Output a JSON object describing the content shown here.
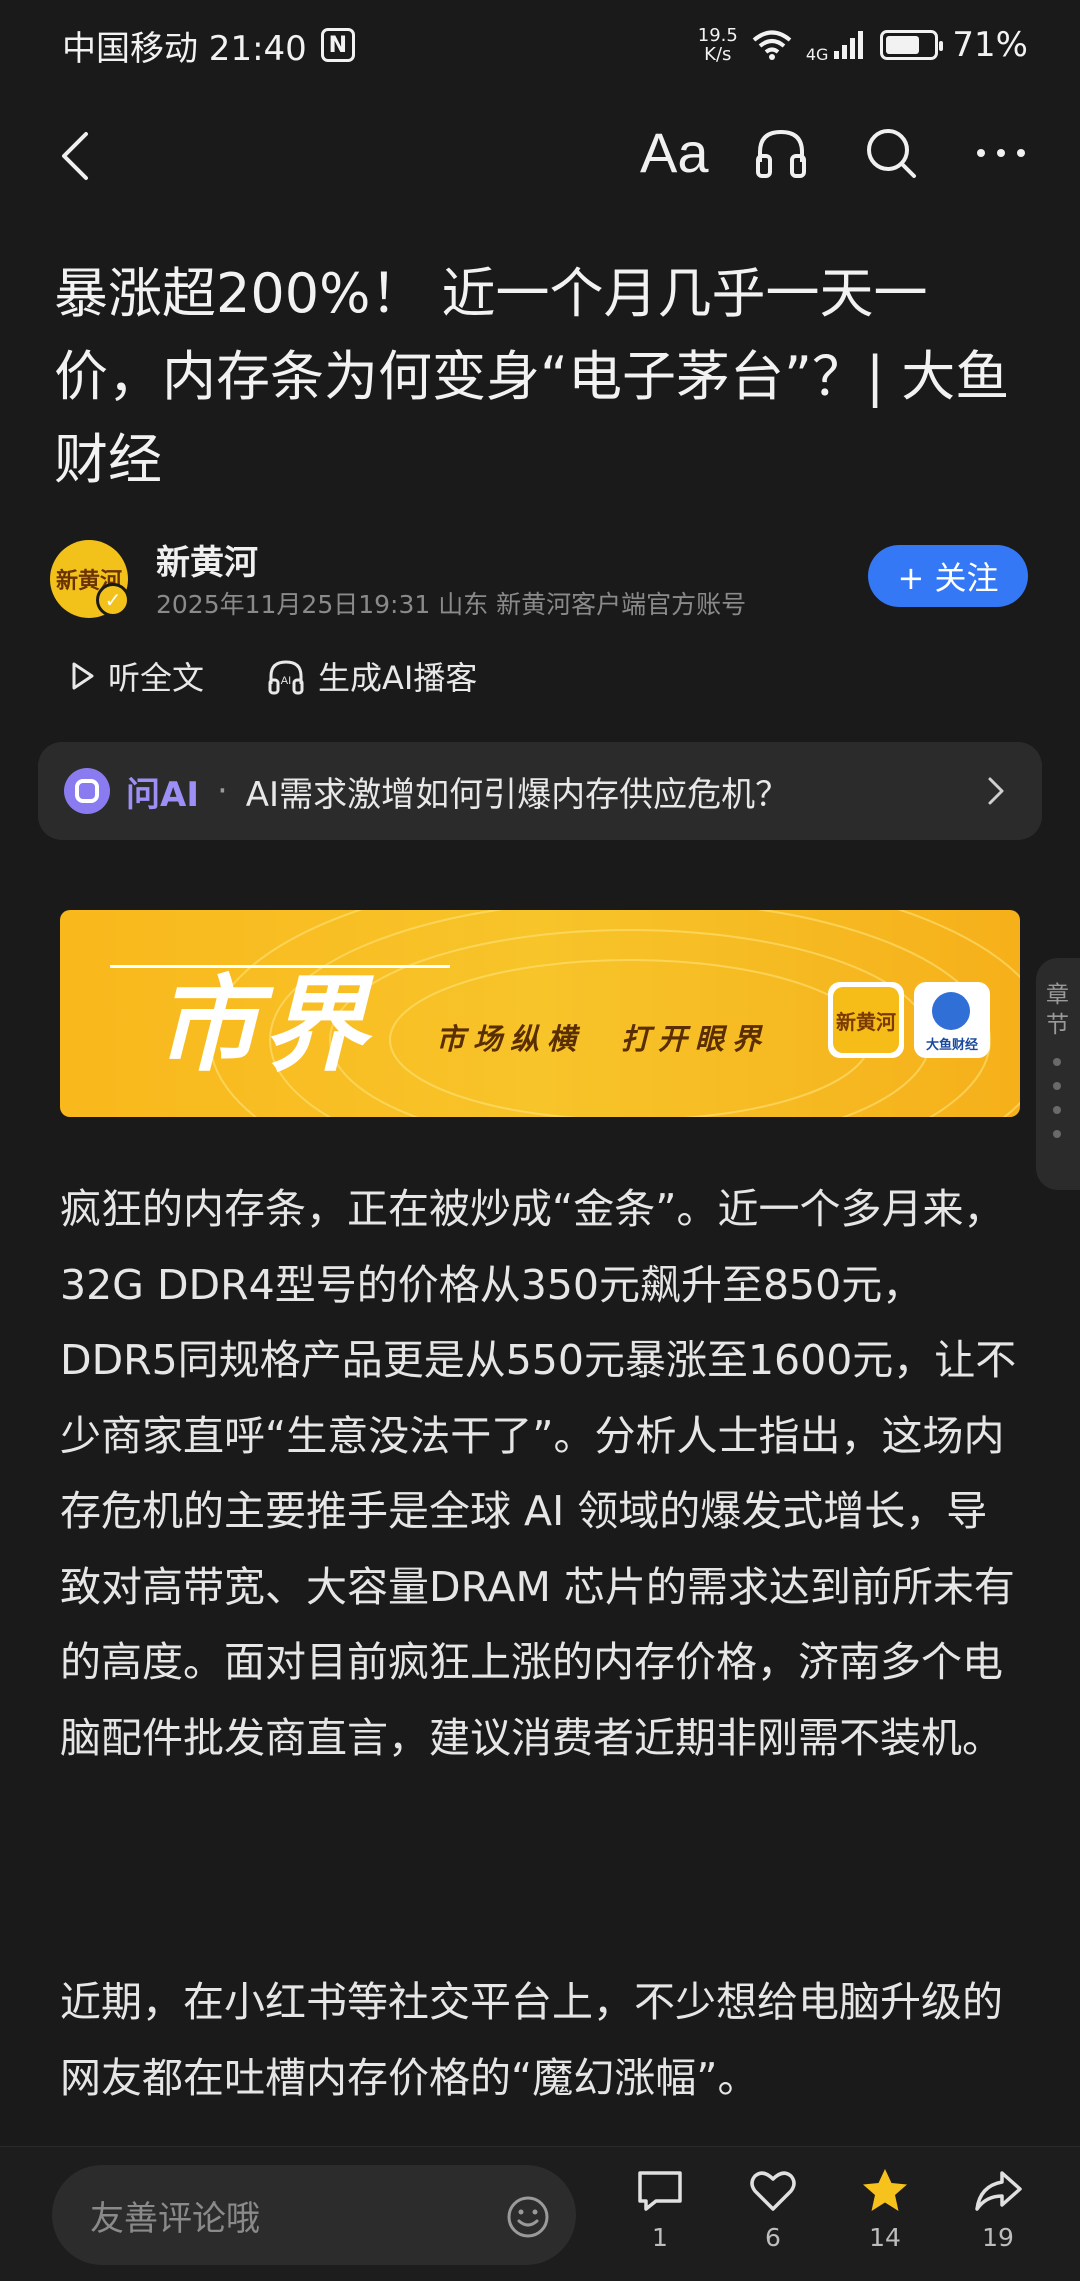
{
  "status_bar": {
    "carrier_time": "中国移动 21:40",
    "nfc": "N",
    "net_speed_value": "19.5",
    "net_speed_unit": "K/s",
    "signal_type": "4G",
    "battery": "71%",
    "battery_level": 0.71
  },
  "top_bar": {
    "font_size_label": "Aa",
    "icons": [
      "back-icon",
      "font-size-icon",
      "headphone-icon",
      "search-icon",
      "more-icon"
    ]
  },
  "article": {
    "title": "暴涨超200%！ 近一个月几乎一天一价，内存条为何变身“电子茅台”？| 大鱼财经",
    "author": {
      "name": "新黄河",
      "avatar_text": "新黄河",
      "meta": "2025年11月25日19:31 山东 新黄河客户端官方账号",
      "follow_label": "+ 关注"
    },
    "actions": {
      "listen_label": "听全文",
      "podcast_label": "生成AI播客",
      "podcast_ai_tag": "AI"
    },
    "ask_ai": {
      "label": "问AI",
      "separator": "·",
      "question": "AI需求激增如何引爆内存供应危机？"
    },
    "banner": {
      "title": "市界",
      "slogan": "市场纵横　打开眼界",
      "logo_a_text": "新黄河",
      "logo_b_text": "大鱼财经"
    },
    "chapter_handle_label": "章节",
    "paragraphs": [
      "疯狂的内存条，正在被炒成“金条”。近一个多月来，32G DDR4型号的价格从350元飙升至850元，DDR5同规格产品更是从550元暴涨至1600元，让不少商家直呼“生意没法干了”。分析人士指出，这场内存危机的主要推手是全球 AI 领域的爆发式增长，导致对高带宽、大容量DRAM 芯片的需求达到前所未有的高度。面对目前疯狂上涨的内存价格，济南多个电脑配件批发商直言，建议消费者近期非刚需不装机。",
      "近期，在小红书等社交平台上，不少想给电脑升级的网友都在吐槽内存价格的“魔幻涨幅”。"
    ]
  },
  "bottom_bar": {
    "comment_placeholder": "友善评论哦",
    "comment_count": "1",
    "like_count": "6",
    "favorite_count": "14",
    "share_count": "19"
  },
  "colors": {
    "background": "#1a1a1a",
    "accent_blue": "#3478f6",
    "ai_purple": "#9c8ff5",
    "favorite_yellow": "#f7c21b",
    "banner_yellow": "#f7c42a"
  }
}
